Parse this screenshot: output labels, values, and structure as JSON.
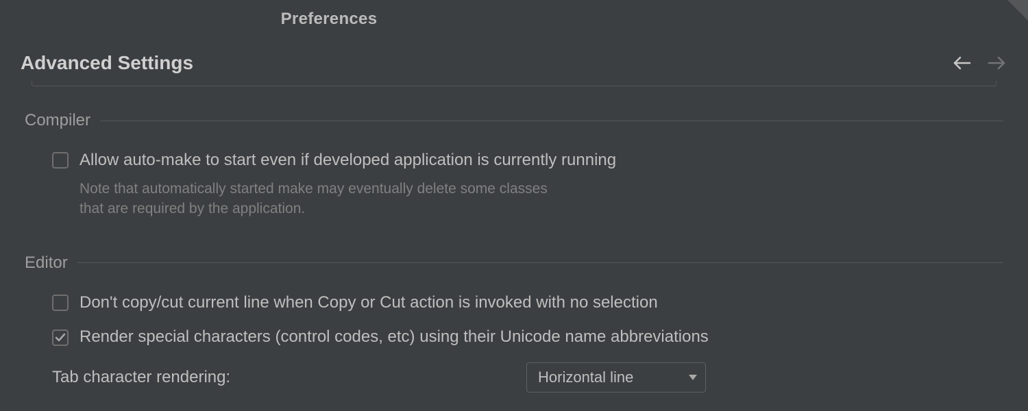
{
  "window": {
    "title": "Preferences"
  },
  "section": {
    "title": "Advanced Settings"
  },
  "groups": {
    "compiler": {
      "name": "Compiler",
      "auto_make_label": "Allow auto-make to start even if developed application is currently running",
      "auto_make_note": "Note that automatically started make may eventually delete some classes that are required by the application."
    },
    "editor": {
      "name": "Editor",
      "no_copy_cut_label": "Don't copy/cut current line when Copy or Cut action is invoked with no selection",
      "render_special_label": "Render special characters (control codes, etc) using their Unicode name abbreviations",
      "tab_render_label": "Tab character rendering:",
      "tab_render_value": "Horizontal line"
    }
  }
}
